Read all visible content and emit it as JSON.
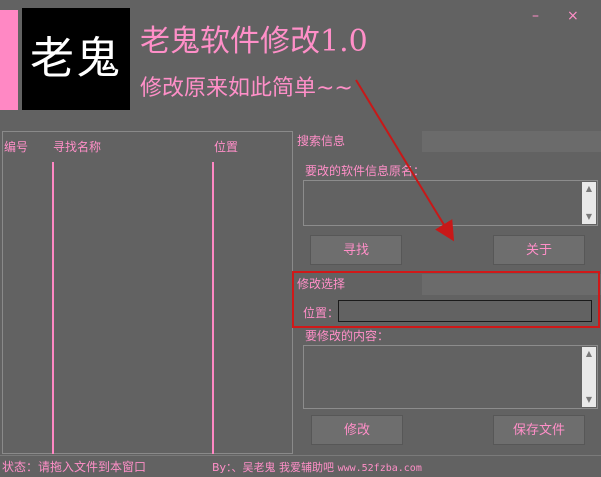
{
  "header": {
    "logo_text": "老鬼",
    "title": "老鬼软件修改1.0",
    "subtitle": "修改原来如此简单~~",
    "minimize_glyph": "–",
    "close_glyph": "×"
  },
  "list": {
    "columns": [
      "编号",
      "寻找名称",
      "位置"
    ],
    "rows": []
  },
  "search": {
    "group_title": "搜索信息",
    "original_label": "要改的软件信息原名：",
    "original_value": "",
    "find_button": "寻找",
    "about_button": "关于"
  },
  "modify": {
    "group_title": "修改选择",
    "position_label": "位置：",
    "position_value": "",
    "content_label": "要修改的内容：",
    "content_value": "",
    "modify_button": "修改",
    "save_button": "保存文件"
  },
  "footer": {
    "status": "状态：请拖入文件到本窗口",
    "credit": "By：、吴老鬼  我爱辅助吧",
    "url": "www.52fzba.com"
  },
  "colors": {
    "background": "#626262",
    "accent_pink": "#ff88c4",
    "highlight_red": "#d01818"
  }
}
